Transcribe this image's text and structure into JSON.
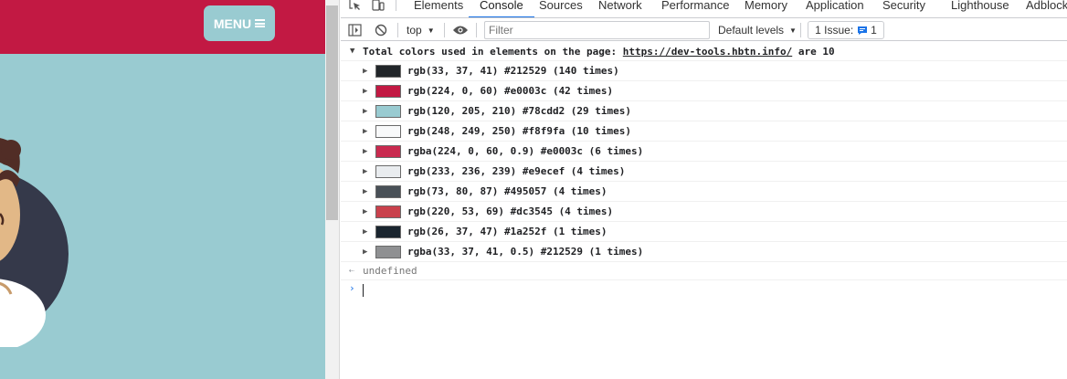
{
  "page": {
    "menu_label": "MENU",
    "colors": {
      "header": "#c21943",
      "background": "#99cbd1"
    }
  },
  "devtools": {
    "tabs": [
      "Elements",
      "Console",
      "Sources",
      "Network",
      "Performance",
      "Memory",
      "Application",
      "Security",
      "Lighthouse",
      "Adblock"
    ],
    "active_tab": "Console",
    "toolbar": {
      "context": "top",
      "filter_placeholder": "Filter",
      "levels": "Default levels",
      "issues_label": "1 Issue:",
      "issues_count": "1"
    },
    "console": {
      "header_prefix": "Total colors used in elements on the page:",
      "header_url": "https://dev-tools.hbtn.info/",
      "header_suffix": "are 10",
      "rows": [
        {
          "text": "rgb(33, 37, 41) #212529 (140 times)",
          "swatch": "#212529"
        },
        {
          "text": "rgb(224, 0, 60) #e0003c (42 times)",
          "swatch": "#c21943"
        },
        {
          "text": "rgb(120, 205, 210) #78cdd2 (29 times)",
          "swatch": "#99cbd1"
        },
        {
          "text": "rgb(248, 249, 250) #f8f9fa (10 times)",
          "swatch": "#f8f9fa"
        },
        {
          "text": "rgba(224, 0, 60, 0.9) #e0003c (6 times)",
          "swatch": "#c92a4f"
        },
        {
          "text": "rgb(233, 236, 239) #e9ecef (4 times)",
          "swatch": "#e9ecef"
        },
        {
          "text": "rgb(73, 80, 87) #495057 (4 times)",
          "swatch": "#495057"
        },
        {
          "text": "rgb(220, 53, 69) #dc3545 (4 times)",
          "swatch": "#c9414c"
        },
        {
          "text": "rgb(26, 37, 47) #1a252f (1 times)",
          "swatch": "#1a252f"
        },
        {
          "text": "rgba(33, 37, 41, 0.5) #212529 (1 times)",
          "swatch": "#8f9092"
        }
      ],
      "result": "undefined"
    }
  }
}
